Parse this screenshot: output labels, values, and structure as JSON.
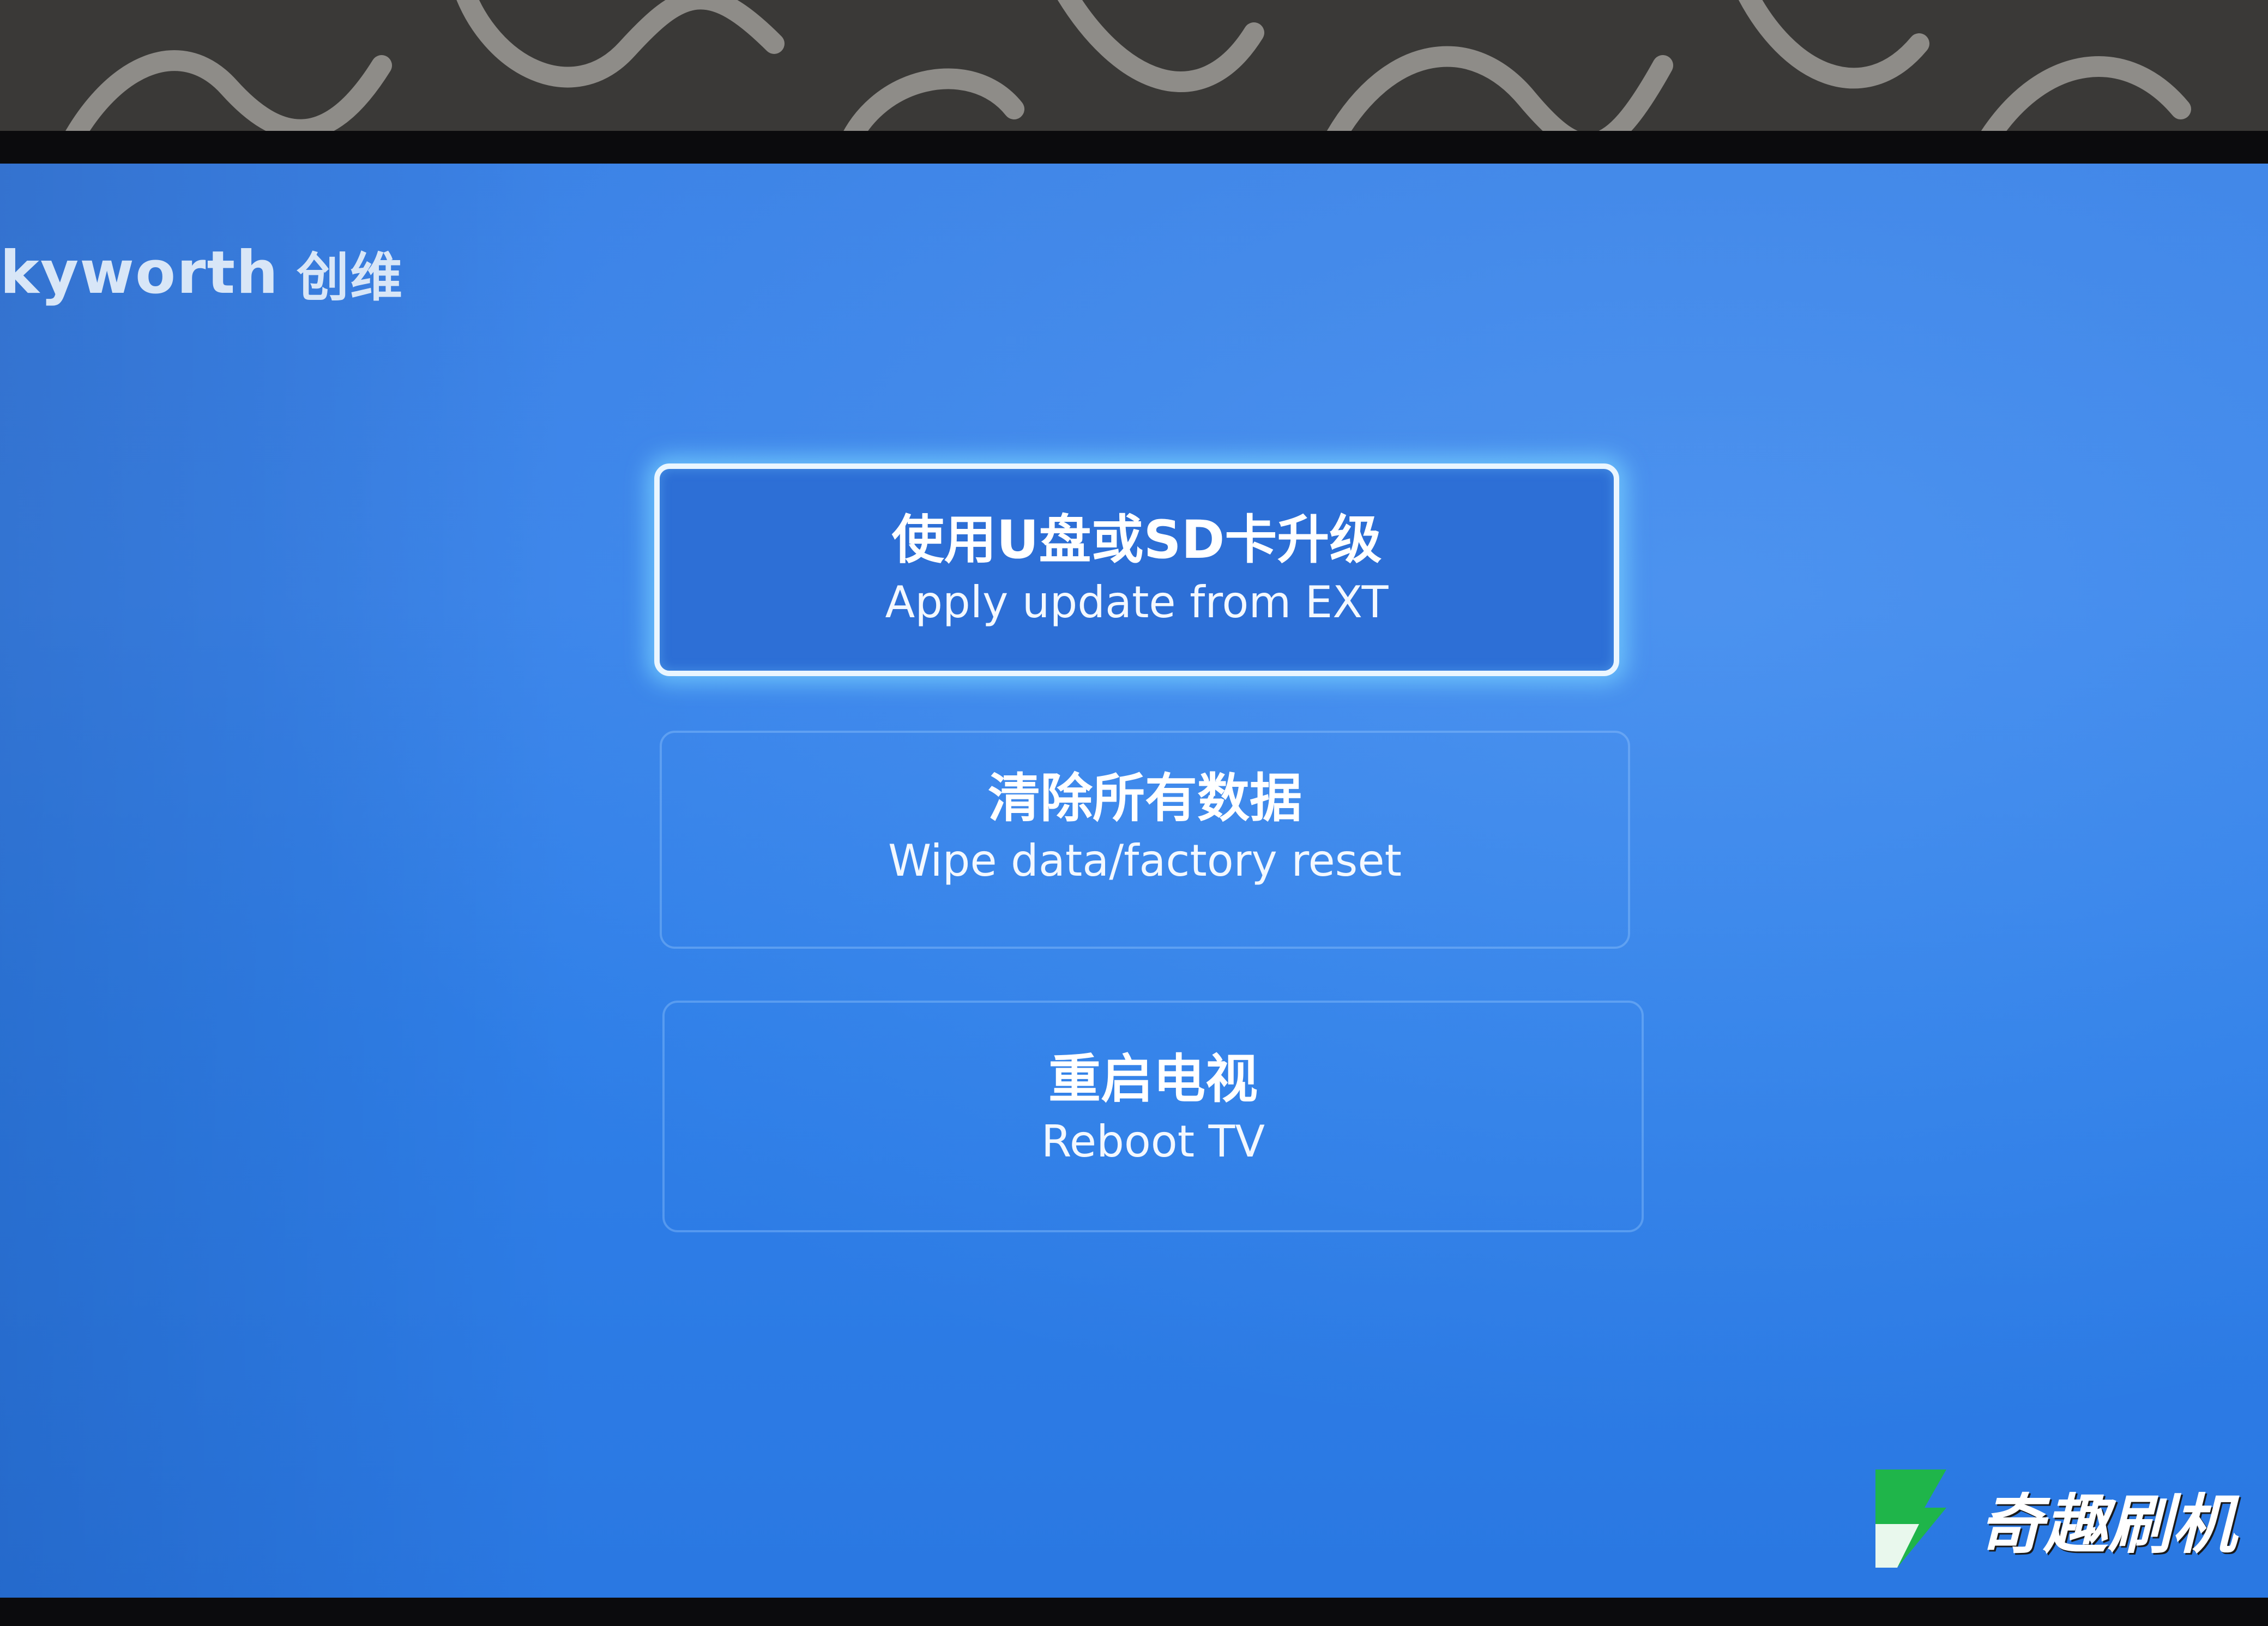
{
  "brand": {
    "name": "kyworth",
    "chinese_name": "创维"
  },
  "menu": {
    "items": [
      {
        "label_cn": "使用U盘或SD卡升级",
        "label_en": "Apply update from EXT",
        "selected": true
      },
      {
        "label_cn": "清除所有数据",
        "label_en": "Wipe data/factory reset",
        "selected": false
      },
      {
        "label_cn": "重启电视",
        "label_en": "Reboot TV",
        "selected": false
      }
    ]
  },
  "watermark": {
    "text": "奇趣刷机",
    "logo_icon": "green-b-logo-icon"
  },
  "colors": {
    "screen_background": "#3a84ea",
    "selected_item_fill": "#2d6fd6",
    "selected_border": "#eaf6ff",
    "selected_glow": "#78d2ff",
    "text": "#ffffff",
    "watermark_logo": "#1fb54a"
  }
}
